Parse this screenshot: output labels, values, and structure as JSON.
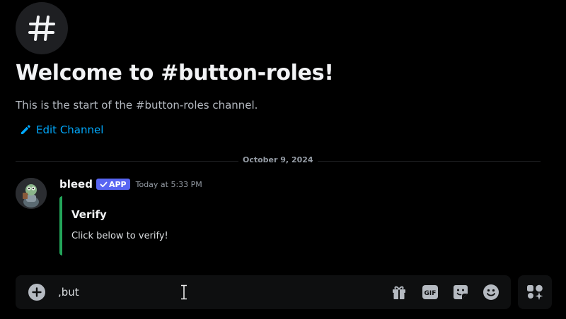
{
  "channel": {
    "welcome_title": "Welcome to #button-roles!",
    "welcome_subtitle": "This is the start of the #button-roles channel.",
    "edit_label": "Edit Channel"
  },
  "date_divider": "October 9, 2024",
  "message": {
    "author": "bleed",
    "tag": "APP",
    "timestamp": "Today at 5:33 PM",
    "embed": {
      "title": "Verify",
      "description": "Click below to verify!",
      "accent_color": "#23a55a"
    }
  },
  "composer": {
    "value": ",but",
    "tools": {
      "gif_label": "GIF"
    }
  },
  "icons": [
    "hash-icon",
    "pencil-icon",
    "check-icon",
    "add-circle-icon",
    "text-cursor-icon",
    "gift-icon",
    "gif-icon",
    "sticker-icon",
    "emoji-icon",
    "apps-icon"
  ],
  "colors": {
    "background": "#000000",
    "link": "#00a8fc",
    "app_tag": "#5865f2",
    "embed_accent": "#23a55a"
  }
}
